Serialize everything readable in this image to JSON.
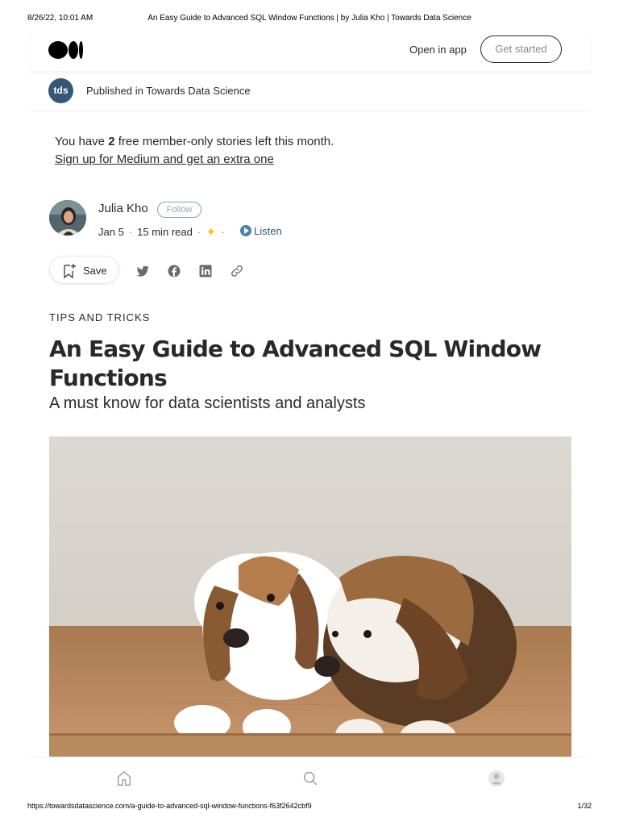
{
  "print_header": {
    "datetime": "8/26/22, 10:01 AM",
    "page_title": "An Easy Guide to Advanced SQL Window Functions | by Julia Kho | Towards Data Science"
  },
  "topbar": {
    "logo": "medium-logo-icon",
    "open_in_app": "Open in app",
    "get_started": "Get started"
  },
  "publication": {
    "badge": "tds",
    "text": "Published in Towards Data Science",
    "badge_color": "#355876"
  },
  "member_note": {
    "prefix": "You have ",
    "count": "2",
    "suffix": " free member-only stories left this month.",
    "signup": "Sign up for Medium and get an extra one"
  },
  "author": {
    "name": "Julia Kho",
    "follow": "Follow",
    "date": "Jan 5",
    "read_time": "15 min read",
    "member_icon": "star-icon",
    "listen": "Listen"
  },
  "actions": {
    "save": "Save",
    "icons": [
      "bookmark-add-icon",
      "twitter-icon",
      "facebook-icon",
      "linkedin-icon",
      "link-icon"
    ]
  },
  "article": {
    "kicker": "TIPS AND TRICKS",
    "title": "An Easy Guide to Advanced SQL Window Functions",
    "subtitle": "A must know for data scientists and analysts"
  },
  "bottom_nav": {
    "icons": [
      "home-icon",
      "search-icon",
      "profile-icon"
    ]
  },
  "print_footer": {
    "url": "https://towardsdatascience.com/a-guide-to-advanced-sql-window-functions-f63f2642cbf9",
    "pages": "1/32"
  },
  "colors": {
    "text": "#292929",
    "accent_listen": "#355876",
    "star": "#ffc017"
  }
}
